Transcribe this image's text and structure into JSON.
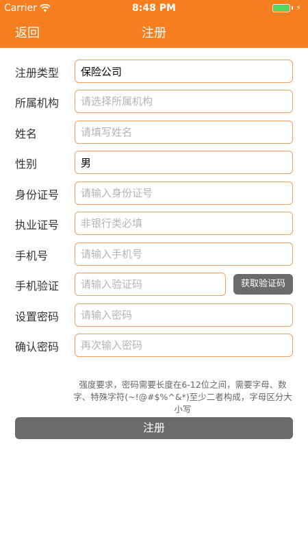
{
  "status_bar": {
    "carrier": "Carrier",
    "time": "8:48 PM",
    "battery_color": "#4cd964",
    "icons": [
      "wifi-icon",
      "battery-icon",
      "charging-bolt-icon"
    ]
  },
  "nav": {
    "back_label": "返回",
    "title": "注册",
    "background": "#f57f20"
  },
  "form": {
    "fields": [
      {
        "label": "注册类型",
        "value": "保险公司",
        "placeholder": ""
      },
      {
        "label": "所属机构",
        "value": "",
        "placeholder": "请选择所属机构"
      },
      {
        "label": "姓名",
        "value": "",
        "placeholder": "请填写姓名"
      },
      {
        "label": "性别",
        "value": "男",
        "placeholder": ""
      },
      {
        "label": "身份证号",
        "value": "",
        "placeholder": "请输入身份证号"
      },
      {
        "label": "执业证号",
        "value": "",
        "placeholder": "非银行类必填"
      },
      {
        "label": "手机号",
        "value": "",
        "placeholder": "请输入手机号"
      },
      {
        "label": "手机验证",
        "value": "",
        "placeholder": "请输入验证码"
      },
      {
        "label": "设置密码",
        "value": "",
        "placeholder": "请输入密码"
      },
      {
        "label": "确认密码",
        "value": "",
        "placeholder": "再次输入密码"
      }
    ],
    "get_code_label": "获取验证码",
    "password_hint": "强度要求，密码需要长度在6-12位之间，需要字母、数字、特殊字符(~!@#$%^&*)至少二者构成，字母区分大小写",
    "submit_label": "注册",
    "border_color": "#f0a060",
    "button_color": "#6b6b6b"
  }
}
